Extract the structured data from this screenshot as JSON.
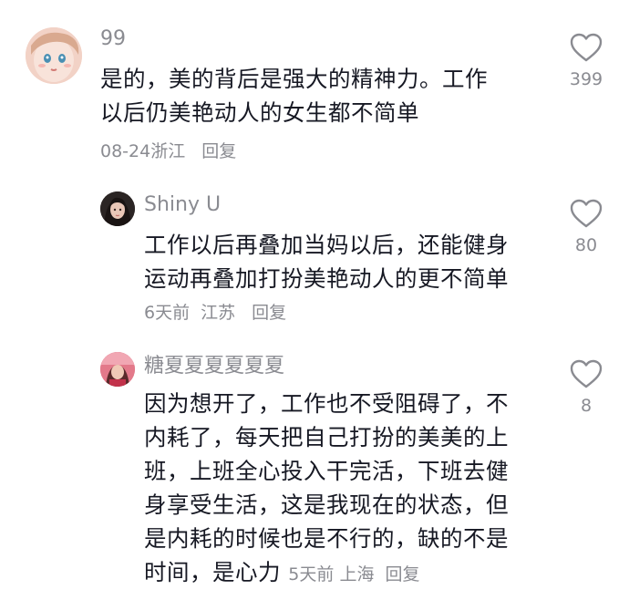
{
  "comments": [
    {
      "username": "99",
      "text_lines": [
        "是的，美的背后是强大的精神力。工作",
        "以后仍美艳动人的女生都不简单"
      ],
      "time": "08-24",
      "location": "浙江",
      "reply_label": "回复",
      "likes": "399",
      "like_icon": "heart-outline-icon"
    },
    {
      "username": "Shiny U",
      "text_lines": [
        "工作以后再叠加当妈以后，还能健身",
        "运动再叠加打扮美艳动人的更不简单"
      ],
      "time": "6天前",
      "location": "江苏",
      "reply_label": "回复",
      "likes": "80",
      "like_icon": "heart-outline-icon"
    },
    {
      "username": "糖夏夏夏夏夏夏",
      "text_lines": [
        "因为想开了，工作也不受阻碍了，不",
        "内耗了，每天把自己打扮的美美的上",
        "班，上班全心投入干完活，下班去健",
        "身享受生活，这是我现在的状态，但",
        "是内耗的时候也是不行的，缺的不是",
        "时间，是心力"
      ],
      "time": "5天前",
      "location": "上海",
      "reply_label": "回复",
      "likes": "8",
      "like_icon": "heart-outline-icon"
    }
  ],
  "colors": {
    "text": "#161823",
    "secondary": "#8a8b91",
    "heart": "#8a8b91"
  }
}
